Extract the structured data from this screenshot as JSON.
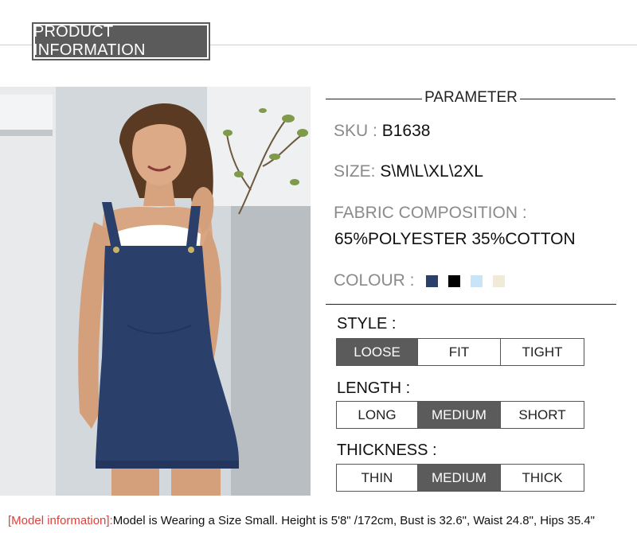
{
  "header": {
    "title": "PRODUCT INFORMATION"
  },
  "parameter": {
    "heading": "PARAMETER",
    "sku_label": "SKU :",
    "sku_value": "B1638",
    "size_label": "SIZE:",
    "size_value": "S\\M\\L\\XL\\2XL",
    "fabric_label": "FABRIC COMPOSITION :",
    "fabric_value": "65%POLYESTER 35%COTTON",
    "colour_label": "COLOUR :",
    "colours": [
      "#2b3f6b",
      "#000000",
      "#c9e3f7",
      "#f2ead8"
    ]
  },
  "style": {
    "title": "STYLE :",
    "options": [
      "LOOSE",
      "FIT",
      "TIGHT"
    ],
    "selected": "LOOSE"
  },
  "length": {
    "title": "LENGTH :",
    "options": [
      "LONG",
      "MEDIUM",
      "SHORT"
    ],
    "selected": "MEDIUM"
  },
  "thickness": {
    "title": "THICKNESS :",
    "options": [
      "THIN",
      "MEDIUM",
      "THICK"
    ],
    "selected": "MEDIUM"
  },
  "footer": {
    "label": "[Model information]:",
    "text": "Model is Wearing a Size Small. Height is 5'8\" /172cm, Bust is 32.6\", Waist 24.8\", Hips 35.4\""
  },
  "colors": {
    "accent_gray": "#5b5b5b",
    "label_gray": "#8a8a8a",
    "footer_red": "#e0403a"
  }
}
